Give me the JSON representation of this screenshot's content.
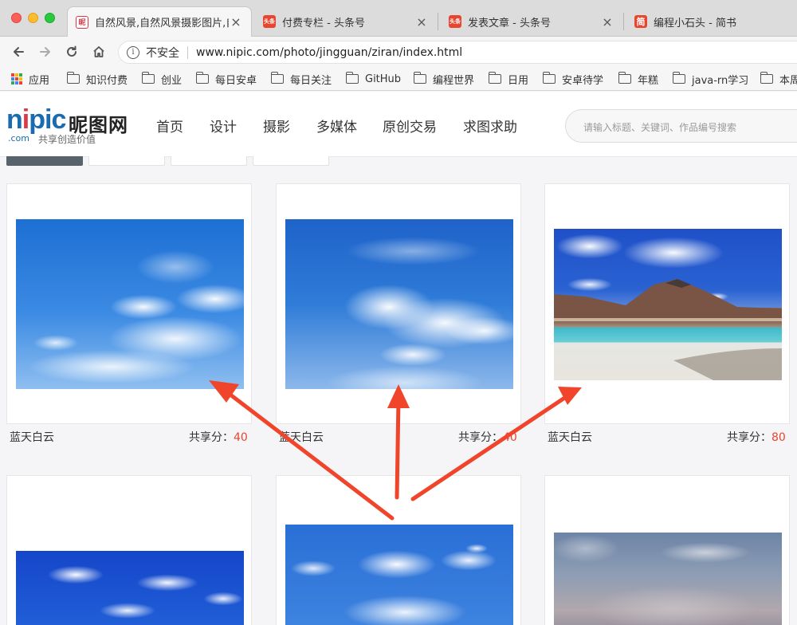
{
  "browser": {
    "tabs": [
      {
        "title": "自然风景,自然风景摄影图片,自",
        "favicon": "昵",
        "favicon_color": "#d93a49",
        "active": true
      },
      {
        "title": "付费专栏 - 头条号",
        "favicon": "头条",
        "favicon_color": "#e8452f",
        "active": false
      },
      {
        "title": "发表文章 - 头条号",
        "favicon": "头条",
        "favicon_color": "#e8452f",
        "active": false
      },
      {
        "title": "编程小石头 - 简书",
        "favicon": "简",
        "favicon_color": "#e8452f",
        "active": false
      }
    ],
    "security_label": "不安全",
    "url": "www.nipic.com/photo/jingguan/ziran/index.html",
    "bookmarks": [
      "应用",
      "知识付费",
      "创业",
      "每日安卓",
      "每日关注",
      "GitHub",
      "编程世界",
      "日用",
      "安卓待学",
      "年糕",
      "java-rn学习",
      "本周"
    ]
  },
  "site": {
    "logo_text": "nipic",
    "logo_cn": "昵图网",
    "logo_dotcom": ".com",
    "logo_slogan": "共享创造价值",
    "nav": [
      "首页",
      "设计",
      "摄影",
      "多媒体",
      "原创交易",
      "求图求助"
    ],
    "search_placeholder": "请输入标题、关键词、作品编号搜索"
  },
  "gallery": {
    "score_label": "共享分：",
    "items": [
      {
        "title": "蓝天白云",
        "score": "40"
      },
      {
        "title": "蓝天白云",
        "score": "40"
      },
      {
        "title": "蓝天白云",
        "score": "80"
      },
      {
        "title": "",
        "score": ""
      },
      {
        "title": "",
        "score": ""
      },
      {
        "title": "",
        "score": ""
      }
    ]
  },
  "annotation_color": "#f0452a"
}
